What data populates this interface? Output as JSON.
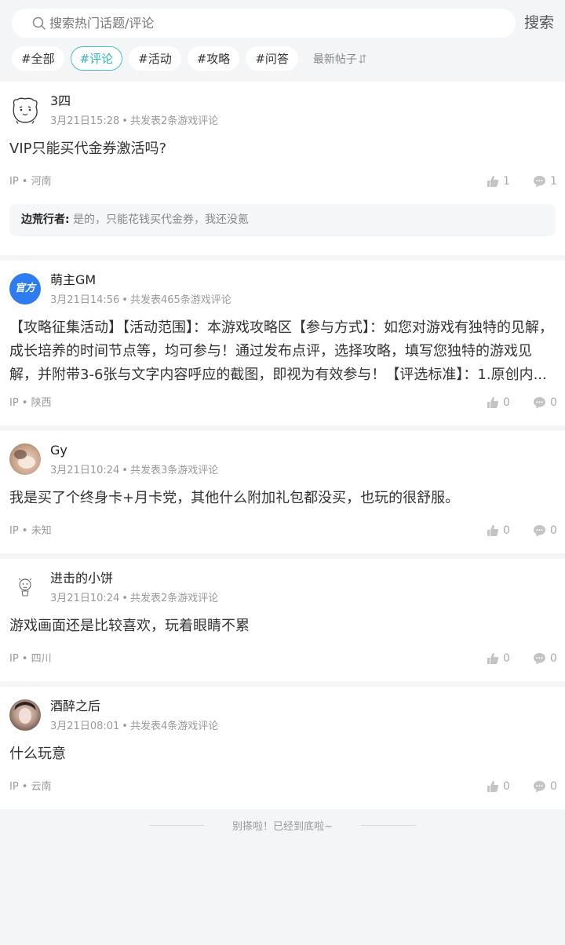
{
  "search": {
    "placeholder": "搜索热门话题/评论",
    "button_label": "搜索"
  },
  "tags": [
    {
      "label": "#全部",
      "active": false
    },
    {
      "label": "#评论",
      "active": true
    },
    {
      "label": "#活动",
      "active": false
    },
    {
      "label": "#攻略",
      "active": false
    },
    {
      "label": "#问答",
      "active": false
    }
  ],
  "sort": {
    "label": "最新帖子"
  },
  "colors": {
    "accent": "#2fb3b8",
    "official_blue": "#2d7cf0",
    "background": "#f4f5f7"
  },
  "posts": [
    {
      "username": "3四",
      "time": "3月21日15:28",
      "count_text": "共发表2条游戏评论",
      "content": "VIP只能买代金券激活吗?",
      "ip": "IP • 河南",
      "likes": "1",
      "comments": "1",
      "reply": {
        "name": "边荒行者:",
        "text": "是的，只能花钱买代金券，我还没氪"
      },
      "avatar": "cartoon-face-icon"
    },
    {
      "username": "萌主GM",
      "time": "3月21日14:56",
      "count_text": "共发表465条游戏评论",
      "content": "【攻略征集活动】【活动范围】：本游戏攻略区【参与方式】：如您对游戏有独特的见解，成长培养的时间节点等，均可参与！通过发布点评，选择攻略，填写您独特的游戏见解，并附带3-6张与文字内容呼应的截图，即视为有效参与！【评选标准】：1.原创内...",
      "ip": "IP • 陕西",
      "likes": "0",
      "comments": "0",
      "avatar_text": "官方"
    },
    {
      "username": "Gy",
      "time": "3月21日10:24",
      "count_text": "共发表3条游戏评论",
      "content": "我是买了个终身卡+月卡党，其他什么附加礼包都没买，也玩的很舒服。",
      "ip": "IP • 未知",
      "likes": "0",
      "comments": "0",
      "avatar": "photo-avatar"
    },
    {
      "username": "进击的小饼",
      "time": "3月21日10:24",
      "count_text": "共发表2条游戏评论",
      "content": "游戏画面还是比较喜欢，玩着眼睛不累",
      "ip": "IP • 四川",
      "likes": "0",
      "comments": "0",
      "avatar": "sketch-avatar"
    },
    {
      "username": "酒醉之后",
      "time": "3月21日08:01",
      "count_text": "共发表4条游戏评论",
      "content": "什么玩意",
      "ip": "IP • 云南",
      "likes": "0",
      "comments": "0",
      "avatar": "photo-avatar"
    }
  ],
  "footer": {
    "text": "别搽啦！已经到底啦~"
  }
}
